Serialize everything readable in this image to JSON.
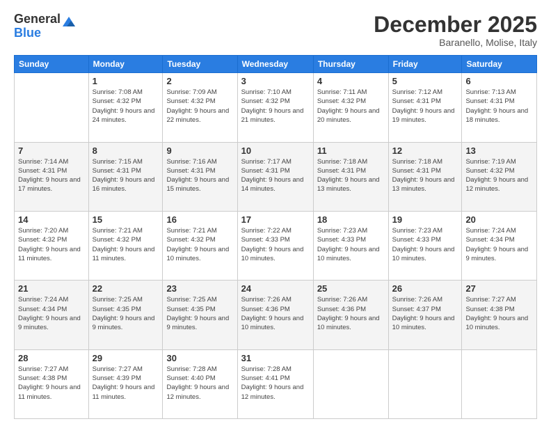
{
  "logo": {
    "general": "General",
    "blue": "Blue"
  },
  "title": "December 2025",
  "subtitle": "Baranello, Molise, Italy",
  "days_of_week": [
    "Sunday",
    "Monday",
    "Tuesday",
    "Wednesday",
    "Thursday",
    "Friday",
    "Saturday"
  ],
  "weeks": [
    [
      {
        "day": "",
        "sunrise": "",
        "sunset": "",
        "daylight": ""
      },
      {
        "day": "1",
        "sunrise": "Sunrise: 7:08 AM",
        "sunset": "Sunset: 4:32 PM",
        "daylight": "Daylight: 9 hours and 24 minutes."
      },
      {
        "day": "2",
        "sunrise": "Sunrise: 7:09 AM",
        "sunset": "Sunset: 4:32 PM",
        "daylight": "Daylight: 9 hours and 22 minutes."
      },
      {
        "day": "3",
        "sunrise": "Sunrise: 7:10 AM",
        "sunset": "Sunset: 4:32 PM",
        "daylight": "Daylight: 9 hours and 21 minutes."
      },
      {
        "day": "4",
        "sunrise": "Sunrise: 7:11 AM",
        "sunset": "Sunset: 4:32 PM",
        "daylight": "Daylight: 9 hours and 20 minutes."
      },
      {
        "day": "5",
        "sunrise": "Sunrise: 7:12 AM",
        "sunset": "Sunset: 4:31 PM",
        "daylight": "Daylight: 9 hours and 19 minutes."
      },
      {
        "day": "6",
        "sunrise": "Sunrise: 7:13 AM",
        "sunset": "Sunset: 4:31 PM",
        "daylight": "Daylight: 9 hours and 18 minutes."
      }
    ],
    [
      {
        "day": "7",
        "sunrise": "Sunrise: 7:14 AM",
        "sunset": "Sunset: 4:31 PM",
        "daylight": "Daylight: 9 hours and 17 minutes."
      },
      {
        "day": "8",
        "sunrise": "Sunrise: 7:15 AM",
        "sunset": "Sunset: 4:31 PM",
        "daylight": "Daylight: 9 hours and 16 minutes."
      },
      {
        "day": "9",
        "sunrise": "Sunrise: 7:16 AM",
        "sunset": "Sunset: 4:31 PM",
        "daylight": "Daylight: 9 hours and 15 minutes."
      },
      {
        "day": "10",
        "sunrise": "Sunrise: 7:17 AM",
        "sunset": "Sunset: 4:31 PM",
        "daylight": "Daylight: 9 hours and 14 minutes."
      },
      {
        "day": "11",
        "sunrise": "Sunrise: 7:18 AM",
        "sunset": "Sunset: 4:31 PM",
        "daylight": "Daylight: 9 hours and 13 minutes."
      },
      {
        "day": "12",
        "sunrise": "Sunrise: 7:18 AM",
        "sunset": "Sunset: 4:31 PM",
        "daylight": "Daylight: 9 hours and 13 minutes."
      },
      {
        "day": "13",
        "sunrise": "Sunrise: 7:19 AM",
        "sunset": "Sunset: 4:32 PM",
        "daylight": "Daylight: 9 hours and 12 minutes."
      }
    ],
    [
      {
        "day": "14",
        "sunrise": "Sunrise: 7:20 AM",
        "sunset": "Sunset: 4:32 PM",
        "daylight": "Daylight: 9 hours and 11 minutes."
      },
      {
        "day": "15",
        "sunrise": "Sunrise: 7:21 AM",
        "sunset": "Sunset: 4:32 PM",
        "daylight": "Daylight: 9 hours and 11 minutes."
      },
      {
        "day": "16",
        "sunrise": "Sunrise: 7:21 AM",
        "sunset": "Sunset: 4:32 PM",
        "daylight": "Daylight: 9 hours and 10 minutes."
      },
      {
        "day": "17",
        "sunrise": "Sunrise: 7:22 AM",
        "sunset": "Sunset: 4:33 PM",
        "daylight": "Daylight: 9 hours and 10 minutes."
      },
      {
        "day": "18",
        "sunrise": "Sunrise: 7:23 AM",
        "sunset": "Sunset: 4:33 PM",
        "daylight": "Daylight: 9 hours and 10 minutes."
      },
      {
        "day": "19",
        "sunrise": "Sunrise: 7:23 AM",
        "sunset": "Sunset: 4:33 PM",
        "daylight": "Daylight: 9 hours and 10 minutes."
      },
      {
        "day": "20",
        "sunrise": "Sunrise: 7:24 AM",
        "sunset": "Sunset: 4:34 PM",
        "daylight": "Daylight: 9 hours and 9 minutes."
      }
    ],
    [
      {
        "day": "21",
        "sunrise": "Sunrise: 7:24 AM",
        "sunset": "Sunset: 4:34 PM",
        "daylight": "Daylight: 9 hours and 9 minutes."
      },
      {
        "day": "22",
        "sunrise": "Sunrise: 7:25 AM",
        "sunset": "Sunset: 4:35 PM",
        "daylight": "Daylight: 9 hours and 9 minutes."
      },
      {
        "day": "23",
        "sunrise": "Sunrise: 7:25 AM",
        "sunset": "Sunset: 4:35 PM",
        "daylight": "Daylight: 9 hours and 9 minutes."
      },
      {
        "day": "24",
        "sunrise": "Sunrise: 7:26 AM",
        "sunset": "Sunset: 4:36 PM",
        "daylight": "Daylight: 9 hours and 10 minutes."
      },
      {
        "day": "25",
        "sunrise": "Sunrise: 7:26 AM",
        "sunset": "Sunset: 4:36 PM",
        "daylight": "Daylight: 9 hours and 10 minutes."
      },
      {
        "day": "26",
        "sunrise": "Sunrise: 7:26 AM",
        "sunset": "Sunset: 4:37 PM",
        "daylight": "Daylight: 9 hours and 10 minutes."
      },
      {
        "day": "27",
        "sunrise": "Sunrise: 7:27 AM",
        "sunset": "Sunset: 4:38 PM",
        "daylight": "Daylight: 9 hours and 10 minutes."
      }
    ],
    [
      {
        "day": "28",
        "sunrise": "Sunrise: 7:27 AM",
        "sunset": "Sunset: 4:38 PM",
        "daylight": "Daylight: 9 hours and 11 minutes."
      },
      {
        "day": "29",
        "sunrise": "Sunrise: 7:27 AM",
        "sunset": "Sunset: 4:39 PM",
        "daylight": "Daylight: 9 hours and 11 minutes."
      },
      {
        "day": "30",
        "sunrise": "Sunrise: 7:28 AM",
        "sunset": "Sunset: 4:40 PM",
        "daylight": "Daylight: 9 hours and 12 minutes."
      },
      {
        "day": "31",
        "sunrise": "Sunrise: 7:28 AM",
        "sunset": "Sunset: 4:41 PM",
        "daylight": "Daylight: 9 hours and 12 minutes."
      },
      {
        "day": "",
        "sunrise": "",
        "sunset": "",
        "daylight": ""
      },
      {
        "day": "",
        "sunrise": "",
        "sunset": "",
        "daylight": ""
      },
      {
        "day": "",
        "sunrise": "",
        "sunset": "",
        "daylight": ""
      }
    ]
  ]
}
